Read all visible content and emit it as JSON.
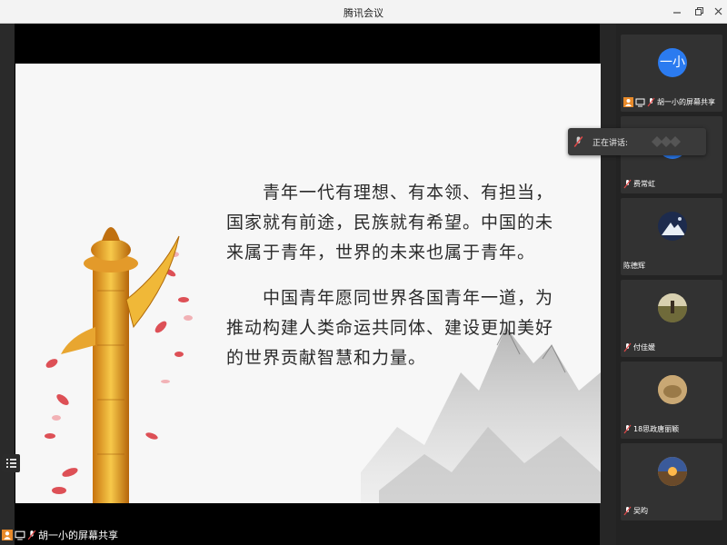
{
  "window": {
    "title": "腾讯会议"
  },
  "slide": {
    "paragraph1": "　　青年一代有理想、有本领、有担当，国家就有前途，民族就有希望。中国的未来属于青年，世界的未来也属于青年。",
    "paragraph2": "　　中国青年愿同世界各国青年一道，为推动构建人类命运共同体、建设更加美好的世界贡献智慧和力量。"
  },
  "speaking_popup": {
    "label": "正在讲话:"
  },
  "share_label": "胡一小的屏幕共享",
  "participants": [
    {
      "name": "胡一小的屏幕共享",
      "avatar_text": "一小",
      "avatar_color": "#2b7bf0",
      "avatar_kind": "text"
    },
    {
      "name": "费常虹",
      "avatar_text": "常虹",
      "avatar_color": "#2b7bf0",
      "avatar_kind": "text"
    },
    {
      "name": "陈德辉",
      "avatar_text": "",
      "avatar_color": "#1d2b4d",
      "avatar_kind": "photo-mountain"
    },
    {
      "name": "付佳媛",
      "avatar_text": "",
      "avatar_color": "#8a7f5c",
      "avatar_kind": "photo-field"
    },
    {
      "name": "18思政唐丽颖",
      "avatar_text": "",
      "avatar_color": "#a8885a",
      "avatar_kind": "photo-rock"
    },
    {
      "name": "吴昀",
      "avatar_text": "",
      "avatar_color": "#e8a040",
      "avatar_kind": "photo-sunset"
    }
  ],
  "colors": {
    "accent": "#2b7bf0",
    "speaking_bg": "#3a3a3a",
    "mic_muted": "#e04848"
  }
}
